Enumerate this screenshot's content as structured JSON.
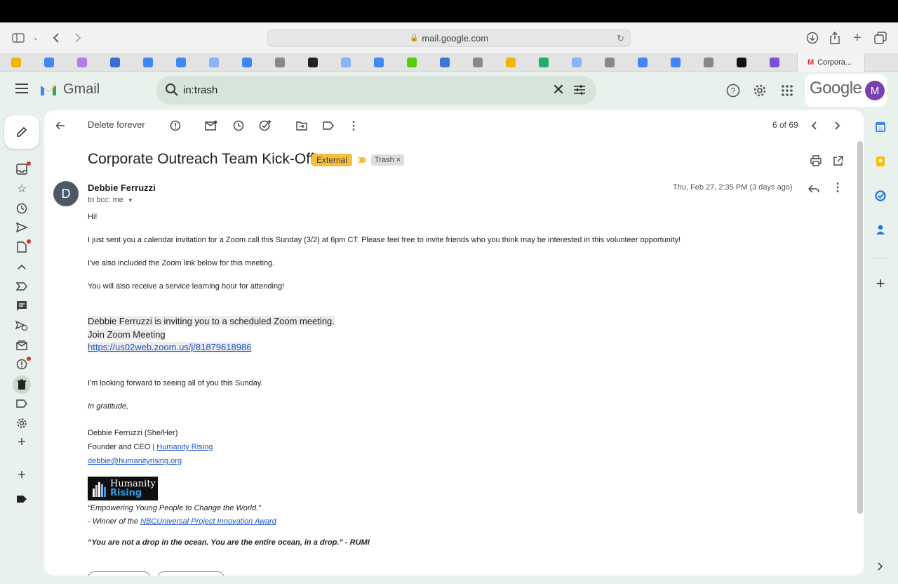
{
  "browser": {
    "url": "mail.google.com",
    "active_tab": {
      "title": "Corpora...",
      "favicon": "M"
    }
  },
  "tabs_icons": [
    {
      "color": "#f4b400",
      "name": "slides-tab-icon"
    },
    {
      "color": "#4285f4",
      "name": "docs-tab-icon"
    },
    {
      "color": "#b57cf0",
      "name": "plus-tab-icon"
    },
    {
      "color": "#3c6ed8",
      "name": "dots-tab-icon"
    },
    {
      "color": "#4285f4",
      "name": "docs-tab-icon"
    },
    {
      "color": "#4285f4",
      "name": "docs-tab-icon"
    },
    {
      "color": "#8ab4f8",
      "name": "p-tab-icon"
    },
    {
      "color": "#4285f4",
      "name": "docs-tab-icon"
    },
    {
      "color": "#888888",
      "name": "g-tab-icon"
    },
    {
      "color": "#222222",
      "name": "notion-tab-icon"
    },
    {
      "color": "#8ab4f8",
      "name": "p-tab-icon"
    },
    {
      "color": "#4285f4",
      "name": "docs-tab-icon"
    },
    {
      "color": "#58cc02",
      "name": "duolingo-tab-icon"
    },
    {
      "color": "#3f74d9",
      "name": "cap-tab-icon"
    },
    {
      "color": "#888888",
      "name": "g-tab-icon"
    },
    {
      "color": "#f4b400",
      "name": "slides-tab-icon"
    },
    {
      "color": "#1fae6a",
      "name": "shield-tab-icon"
    },
    {
      "color": "#8ab4f8",
      "name": "p-tab-icon"
    },
    {
      "color": "#888888",
      "name": "g-tab-icon"
    },
    {
      "color": "#4285f4",
      "name": "docs-tab-icon"
    },
    {
      "color": "#4285f4",
      "name": "docs-tab-icon"
    },
    {
      "color": "#888888",
      "name": "n-tab-icon"
    },
    {
      "color": "#111111",
      "name": "circle-tab-icon"
    },
    {
      "color": "#7b4fd6",
      "name": "heart-tab-icon"
    }
  ],
  "gmail": {
    "brand": "Gmail",
    "search_value": "in:trash",
    "google_word": "Google",
    "avatar_letter": "M"
  },
  "toolbar": {
    "delete_forever": "Delete forever",
    "page_count": "6 of 69"
  },
  "message": {
    "subject": "Corporate Outreach Team Kick-Off!",
    "badge_external": "External",
    "badge_trash": "Trash",
    "sender_initial": "D",
    "sender_name": "Debbie Ferruzzi",
    "to_line": "to bcc: me",
    "date": "Thu, Feb 27, 2:35 PM (3 days ago)",
    "greeting": "Hi!",
    "p1": "I just sent you a calendar invitation for a Zoom call this Sunday (3/2) at 6pm CT.   Please feel free to invite friends who you think may be interested in this volunteer opportunity!",
    "p2": "I've also included the Zoom link below for this meeting.",
    "p3": "You will also receive a service learning hour for attending!",
    "zoom_line1": "Debbie Ferruzzi is inviting you to a scheduled Zoom meeting.",
    "zoom_line2": "Join Zoom Meeting",
    "zoom_link": "https://us02web.zoom.us/j/81879618986",
    "p4": "I'm looking forward to seeing all of you this Sunday.",
    "closing": "In gratitude,",
    "sig_name": "Debbie Ferruzzi  (She/Her)",
    "sig_title": "Founder and CEO | ",
    "sig_org_link": "Humanity Rising",
    "sig_email": "debbie@humanityrising.org",
    "logo_word1": "Humanity",
    "logo_word2": "Rising",
    "quote1": "“Empowering Young People to Change the World.”",
    "award_prefix": "- Winner of the ",
    "award_link": "NBCUniversal Project Innovation Award",
    "quote2": "“You are not a drop in the ocean. You are the entire ocean, in a drop.” - RUMI"
  },
  "colors": {
    "gmail_bg": "#e9f1ed",
    "search_bg": "#d6e4dc",
    "badge_external": "#f5bf3c",
    "link": "#1a55c8",
    "avatar_m": "#7b3fb0"
  }
}
